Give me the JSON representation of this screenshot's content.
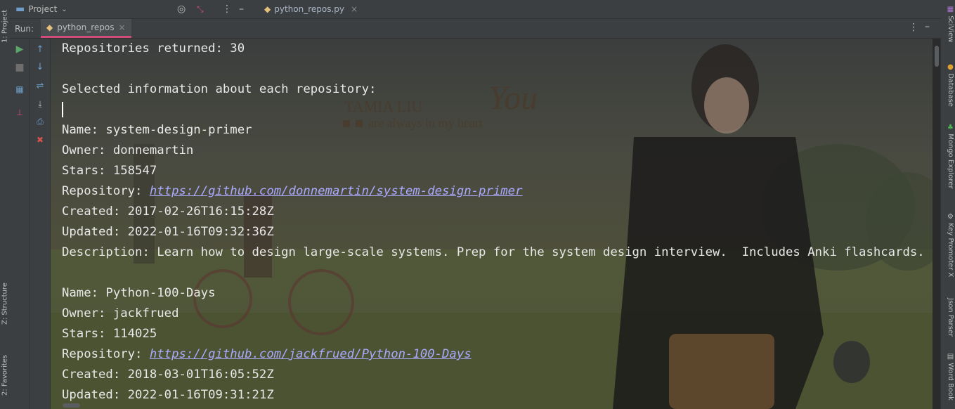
{
  "left_tabs": {
    "project": "1: Project",
    "structure": "Z: Structure",
    "favorites": "2: Favorites"
  },
  "right_tabs": [
    "SciView",
    "Database",
    "Mongo Explorer",
    "Key Promoter X",
    "Json Parser",
    "Word Book"
  ],
  "topbar": {
    "project_label": "Project",
    "editor_tab": "python_repos.py"
  },
  "runbar": {
    "label": "Run:",
    "tab": "python_repos"
  },
  "wallpaper_text": {
    "name": "TAMIA LIU",
    "script": "You",
    "tagline": "are always in my heart"
  },
  "console": {
    "lines": [
      {
        "kind": "text",
        "text": "Repositories returned: 30"
      },
      {
        "kind": "text",
        "text": ""
      },
      {
        "kind": "text",
        "text": "Selected information about each repository:"
      },
      {
        "kind": "caret",
        "text": ""
      },
      {
        "kind": "text",
        "text": "Name: system-design-primer"
      },
      {
        "kind": "text",
        "text": "Owner: donnemartin"
      },
      {
        "kind": "text",
        "text": "Stars: 158547"
      },
      {
        "kind": "link",
        "prefix": "Repository: ",
        "text": "https://github.com/donnemartin/system-design-primer"
      },
      {
        "kind": "text",
        "text": "Created: 2017-02-26T16:15:28Z"
      },
      {
        "kind": "text",
        "text": "Updated: 2022-01-16T09:32:36Z"
      },
      {
        "kind": "text",
        "text": "Description: Learn how to design large-scale systems. Prep for the system design interview.  Includes Anki flashcards."
      },
      {
        "kind": "text",
        "text": ""
      },
      {
        "kind": "text",
        "text": "Name: Python-100-Days"
      },
      {
        "kind": "text",
        "text": "Owner: jackfrued"
      },
      {
        "kind": "text",
        "text": "Stars: 114025"
      },
      {
        "kind": "link",
        "prefix": "Repository: ",
        "text": "https://github.com/jackfrued/Python-100-Days"
      },
      {
        "kind": "text",
        "text": "Created: 2018-03-01T16:05:52Z"
      },
      {
        "kind": "text",
        "text": "Updated: 2022-01-16T09:31:21Z"
      }
    ]
  },
  "colors": {
    "accent": "#d04a7a",
    "link": "#a9a9ff",
    "panel": "#3c3f41"
  }
}
